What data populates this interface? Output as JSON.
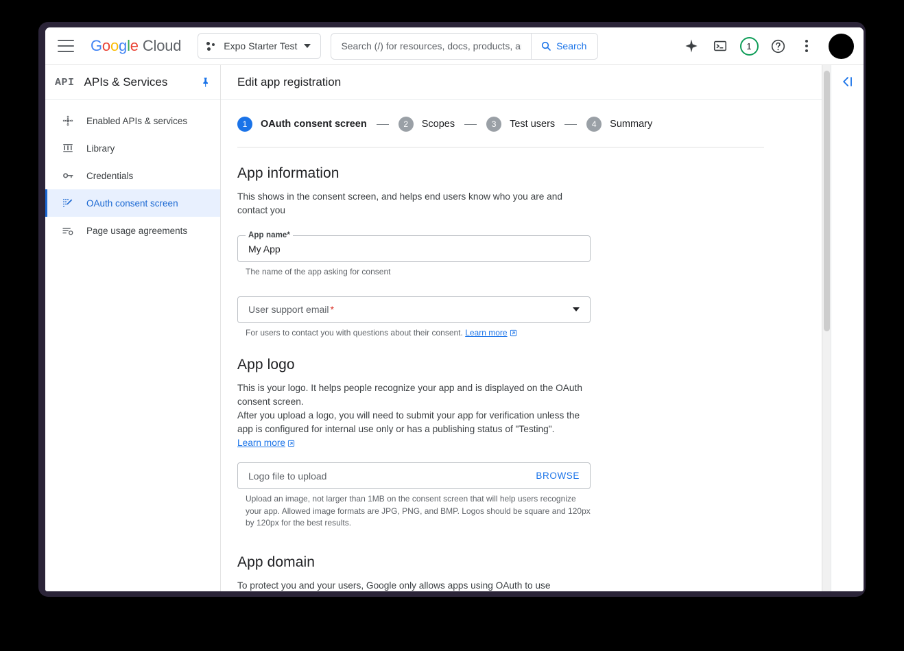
{
  "topbar": {
    "menu_icon": "hamburger-menu-icon",
    "logo": {
      "google": "Google",
      "cloud": "Cloud"
    },
    "project_selector": {
      "label": "Expo Starter Test",
      "icon": "project-dots-icon",
      "caret": "chevron-down-icon"
    },
    "search": {
      "placeholder": "Search (/) for resources, docs, products, and more",
      "value": "",
      "button_label": "Search",
      "icon": "search-icon"
    },
    "icons": [
      {
        "name": "gemini-sparkle-icon"
      },
      {
        "name": "cloud-shell-terminal-icon"
      },
      {
        "name": "notifications-badge",
        "count": "1"
      },
      {
        "name": "help-icon"
      },
      {
        "name": "more-options-kebab-icon"
      },
      {
        "name": "user-avatar"
      }
    ]
  },
  "sidebar": {
    "logo_text": "API",
    "title": "APIs & Services",
    "pin_icon": "pin-icon",
    "items": [
      {
        "label": "Enabled APIs & services",
        "icon": "enabled-apis-icon",
        "active": false
      },
      {
        "label": "Library",
        "icon": "library-icon",
        "active": false
      },
      {
        "label": "Credentials",
        "icon": "key-icon",
        "active": false
      },
      {
        "label": "OAuth consent screen",
        "icon": "consent-screen-icon",
        "active": true
      },
      {
        "label": "Page usage agreements",
        "icon": "page-usage-icon",
        "active": false
      }
    ]
  },
  "page": {
    "title": "Edit app registration",
    "collapse_icon": "collapse-right-panel-icon"
  },
  "stepper": {
    "steps": [
      {
        "num": "1",
        "label": "OAuth consent screen",
        "active": true
      },
      {
        "num": "2",
        "label": "Scopes",
        "active": false
      },
      {
        "num": "3",
        "label": "Test users",
        "active": false
      },
      {
        "num": "4",
        "label": "Summary",
        "active": false
      }
    ]
  },
  "app_information": {
    "title": "App information",
    "description": "This shows in the consent screen, and helps end users know who you are and contact you",
    "app_name_field": {
      "label": "App name",
      "required_marker": "*",
      "value": "My App",
      "helper": "The name of the app asking for consent"
    },
    "support_email_field": {
      "label": "User support email",
      "required_marker": "*",
      "value": "",
      "helper_prefix": "For users to contact you with questions about their consent.",
      "helper_link": "Learn more",
      "caret_icon": "chevron-down-icon"
    }
  },
  "app_logo": {
    "title": "App logo",
    "description_line1": "This is your logo. It helps people recognize your app and is displayed on the OAuth consent screen.",
    "description_line2": "After you upload a logo, you will need to submit your app for verification unless the app is configured for internal use only or has a publishing status of \"Testing\".",
    "description_link": "Learn more",
    "upload_field": {
      "placeholder": "Logo file to upload",
      "value": "",
      "browse_label": "BROWSE",
      "helper": "Upload an image, not larger than 1MB on the consent screen that will help users recognize your app. Allowed image formats are JPG, PNG, and BMP. Logos should be square and 120px by 120px for the best results."
    }
  },
  "app_domain": {
    "title": "App domain",
    "description": "To protect you and your users, Google only allows apps using OAuth to use Authorized"
  },
  "colors": {
    "accent_blue": "#1a73e8",
    "active_nav_bg": "#e8f0fe",
    "active_nav_text": "#1967d2",
    "required_red": "#d93025",
    "badge_green": "#0f9d58",
    "step_inactive": "#9aa0a6",
    "window_frame": "#2b2438"
  }
}
